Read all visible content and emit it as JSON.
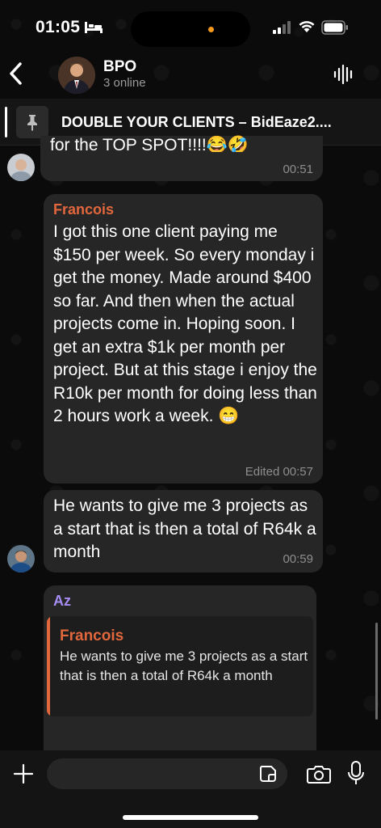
{
  "status_bar": {
    "time": "01:05"
  },
  "header": {
    "title": "BPO",
    "subtitle": "3 online"
  },
  "pinned": {
    "text": "DOUBLE YOUR CLIENTS – BidEaze2...."
  },
  "messages": [
    {
      "text_fragment": "for the TOP SPOT!!!!😂🤣",
      "time": "00:51"
    },
    {
      "sender": "Francois",
      "text": "I got this one client paying me $150 per week. So every monday i get the money. Made around $400 so far. And then when the actual projects come in. Hoping soon. I get an extra $1k per month per project. But at this stage i enjoy the R10k per month for doing less than 2 hours work a week. 😁",
      "time": "Edited 00:57"
    },
    {
      "text": "He wants to give me 3 projects as a start that is then a total of R64k a month",
      "time": "00:59"
    },
    {
      "sender": "Az",
      "reply_to": {
        "sender": "Francois",
        "text": "He wants to give me 3 projects as a start that is then a total of R64k a month"
      }
    }
  ],
  "composer": {
    "placeholder": ""
  },
  "colors": {
    "background": "#0b0b0b",
    "bubble": "#262626",
    "francois_name": "#e2673d",
    "az_name": "#a48cf0",
    "time_text": "#8e8e8e"
  },
  "icons": [
    "back-icon",
    "voice-chat-icon",
    "pin-icon",
    "plus-icon",
    "sticker-icon",
    "camera-icon",
    "mic-icon"
  ]
}
